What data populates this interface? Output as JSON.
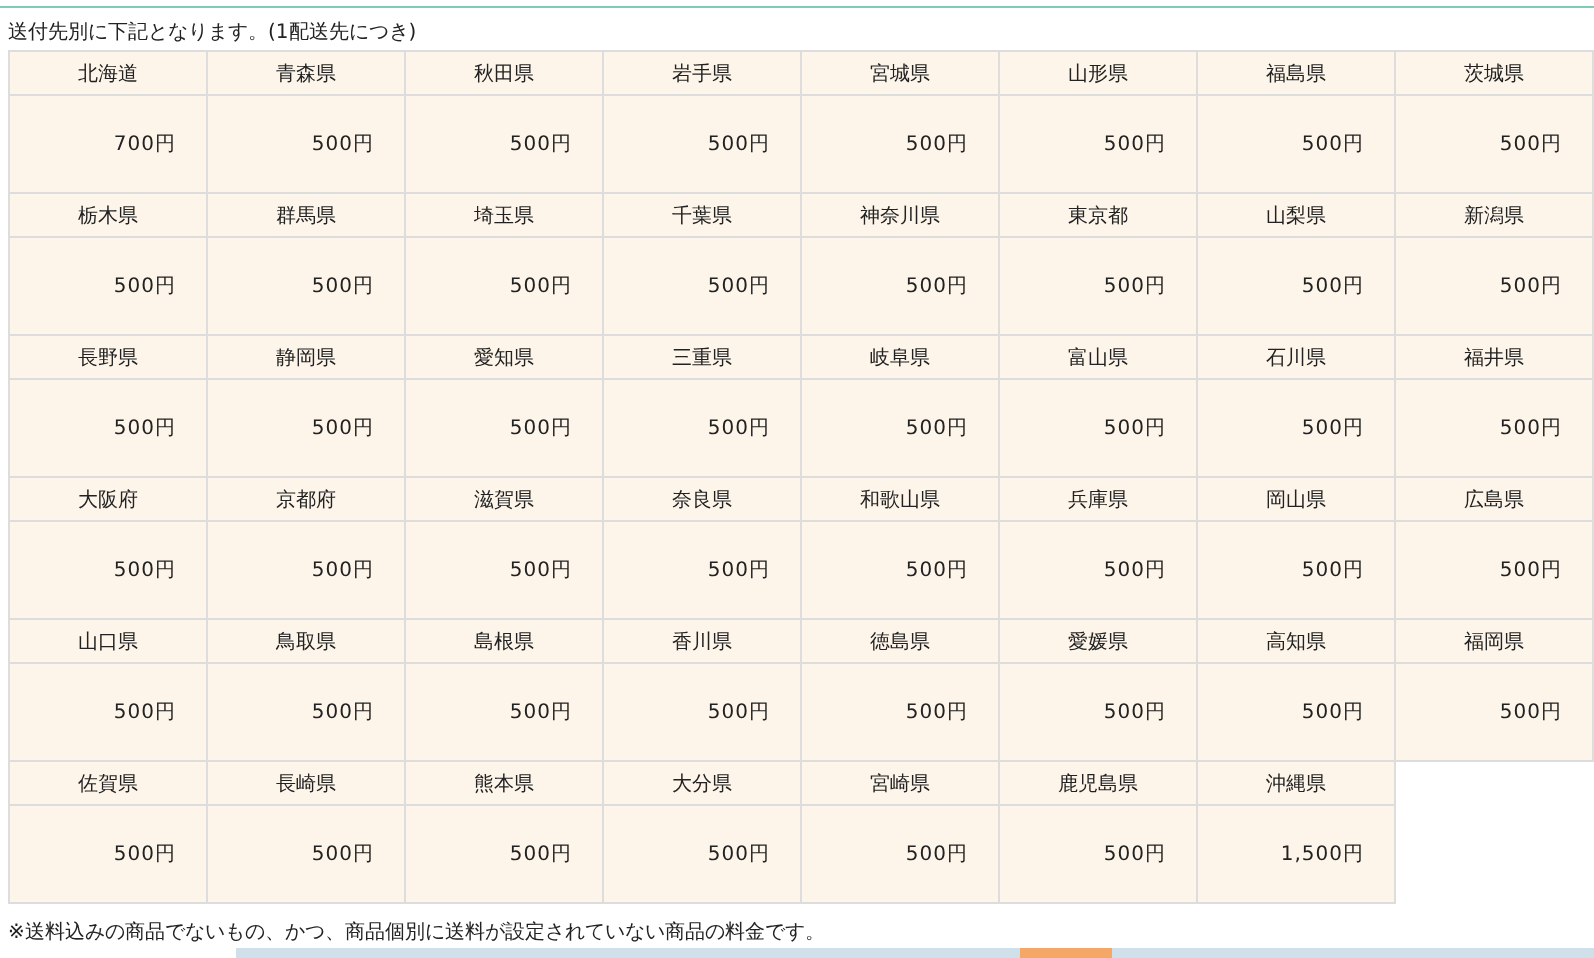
{
  "intro": "送付先別に下記となります。(1配送先につき)",
  "prefectures": [
    {
      "name": "北海道",
      "fee": "700円"
    },
    {
      "name": "青森県",
      "fee": "500円"
    },
    {
      "name": "秋田県",
      "fee": "500円"
    },
    {
      "name": "岩手県",
      "fee": "500円"
    },
    {
      "name": "宮城県",
      "fee": "500円"
    },
    {
      "name": "山形県",
      "fee": "500円"
    },
    {
      "name": "福島県",
      "fee": "500円"
    },
    {
      "name": "茨城県",
      "fee": "500円"
    },
    {
      "name": "栃木県",
      "fee": "500円"
    },
    {
      "name": "群馬県",
      "fee": "500円"
    },
    {
      "name": "埼玉県",
      "fee": "500円"
    },
    {
      "name": "千葉県",
      "fee": "500円"
    },
    {
      "name": "神奈川県",
      "fee": "500円"
    },
    {
      "name": "東京都",
      "fee": "500円"
    },
    {
      "name": "山梨県",
      "fee": "500円"
    },
    {
      "name": "新潟県",
      "fee": "500円"
    },
    {
      "name": "長野県",
      "fee": "500円"
    },
    {
      "name": "静岡県",
      "fee": "500円"
    },
    {
      "name": "愛知県",
      "fee": "500円"
    },
    {
      "name": "三重県",
      "fee": "500円"
    },
    {
      "name": "岐阜県",
      "fee": "500円"
    },
    {
      "name": "富山県",
      "fee": "500円"
    },
    {
      "name": "石川県",
      "fee": "500円"
    },
    {
      "name": "福井県",
      "fee": "500円"
    },
    {
      "name": "大阪府",
      "fee": "500円"
    },
    {
      "name": "京都府",
      "fee": "500円"
    },
    {
      "name": "滋賀県",
      "fee": "500円"
    },
    {
      "name": "奈良県",
      "fee": "500円"
    },
    {
      "name": "和歌山県",
      "fee": "500円"
    },
    {
      "name": "兵庫県",
      "fee": "500円"
    },
    {
      "name": "岡山県",
      "fee": "500円"
    },
    {
      "name": "広島県",
      "fee": "500円"
    },
    {
      "name": "山口県",
      "fee": "500円"
    },
    {
      "name": "鳥取県",
      "fee": "500円"
    },
    {
      "name": "島根県",
      "fee": "500円"
    },
    {
      "name": "香川県",
      "fee": "500円"
    },
    {
      "name": "徳島県",
      "fee": "500円"
    },
    {
      "name": "愛媛県",
      "fee": "500円"
    },
    {
      "name": "高知県",
      "fee": "500円"
    },
    {
      "name": "福岡県",
      "fee": "500円"
    },
    {
      "name": "佐賀県",
      "fee": "500円"
    },
    {
      "name": "長崎県",
      "fee": "500円"
    },
    {
      "name": "熊本県",
      "fee": "500円"
    },
    {
      "name": "大分県",
      "fee": "500円"
    },
    {
      "name": "宮崎県",
      "fee": "500円"
    },
    {
      "name": "鹿児島県",
      "fee": "500円"
    },
    {
      "name": "沖縄県",
      "fee": "1,500円"
    }
  ],
  "note": "※送料込みの商品でないもの、かつ、商品個別に送料が設定されていない商品の料金です。"
}
